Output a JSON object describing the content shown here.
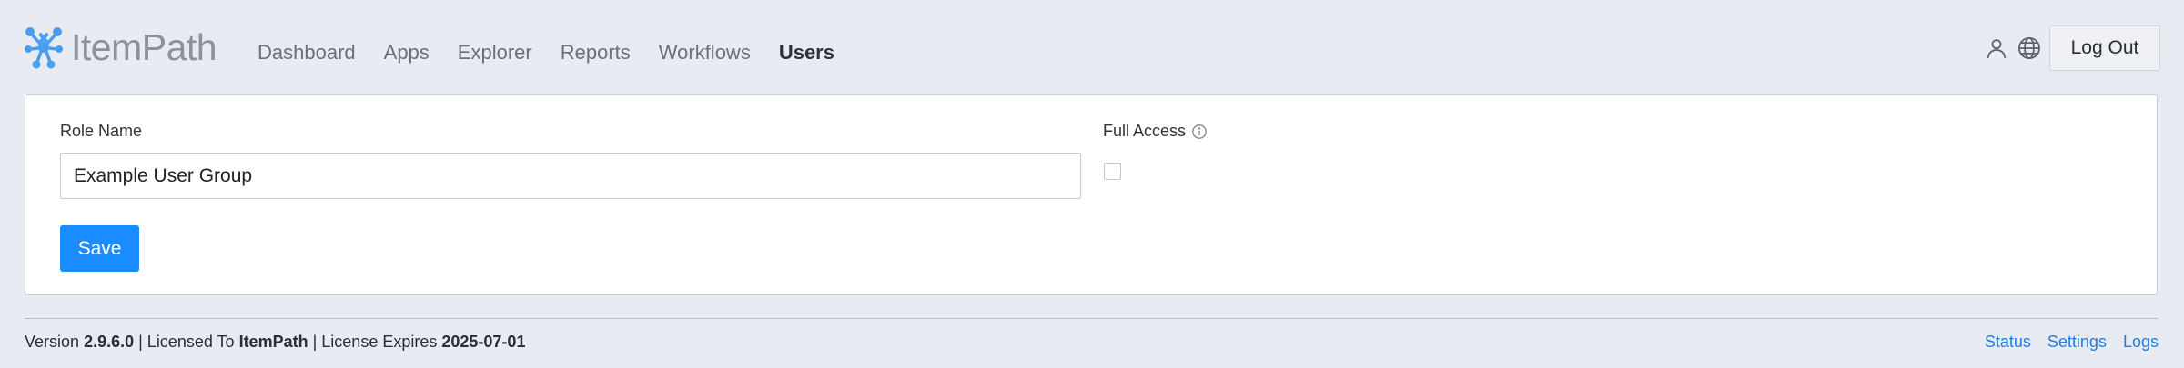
{
  "brand": {
    "name": "ItemPath",
    "accent_color": "#1a8cff",
    "logo_color": "#4a9ef0"
  },
  "nav": {
    "items": [
      {
        "label": "Dashboard"
      },
      {
        "label": "Apps"
      },
      {
        "label": "Explorer"
      },
      {
        "label": "Reports"
      },
      {
        "label": "Workflows"
      },
      {
        "label": "Users"
      }
    ],
    "active": "Users"
  },
  "header_actions": {
    "user_icon": "user-icon",
    "globe_icon": "globe-icon",
    "logout_label": "Log Out"
  },
  "form": {
    "role_name_label": "Role Name",
    "role_name_value": "Example User Group",
    "full_access_label": "Full Access",
    "full_access_checked": false,
    "info_icon": "info-icon",
    "save_label": "Save"
  },
  "footer": {
    "version_prefix": "Version",
    "version": "2.9.6.0",
    "licensed_to_prefix": "| Licensed To",
    "licensed_to": "ItemPath",
    "expires_prefix": "| License Expires",
    "expires": "2025-07-01",
    "links": [
      {
        "label": "Status"
      },
      {
        "label": "Settings"
      },
      {
        "label": "Logs"
      }
    ]
  }
}
